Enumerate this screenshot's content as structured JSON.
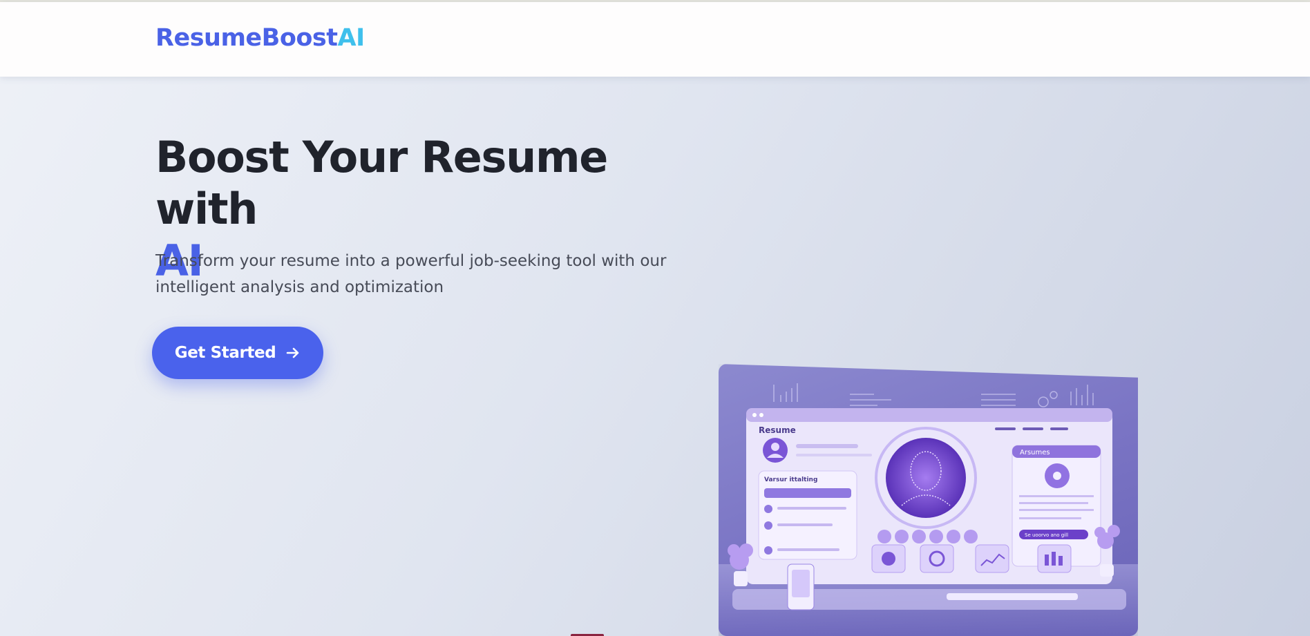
{
  "brand": {
    "name_main": "ResumeBoost",
    "name_accent": "AI"
  },
  "hero": {
    "title_line": "Boost Your Resume with",
    "title_accent": "AI",
    "subtitle": "Transform your resume into a powerful job-seeking tool with our intelligent analysis and optimization",
    "cta_label": "Get Started",
    "cta_icon": "arrow-right-icon"
  },
  "illustration": {
    "app_title": "Resume",
    "panel_title": "Arsumes",
    "section_heading": "Varsur ittalting",
    "button_text": "Se uoorvo ano gill"
  },
  "colors": {
    "primary": "#4a62e6",
    "accent": "#3fc0ec",
    "heading": "#20232c",
    "body_text": "#474b57",
    "header_bg": "#fefdfd"
  }
}
